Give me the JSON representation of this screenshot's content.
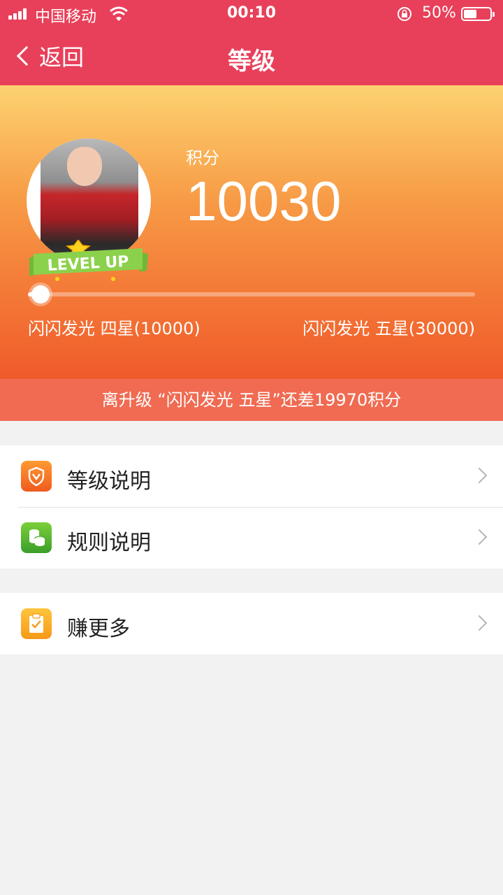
{
  "status_bar": {
    "carrier": "中国移动",
    "time": "00:10",
    "battery_text": "50%",
    "battery_level": 0.5
  },
  "nav": {
    "back_label": "返回",
    "title": "等级"
  },
  "hero": {
    "badge_text": "LEVEL UP",
    "score_label": "积分",
    "score": "10030",
    "progress": 0.003,
    "level_current": "闪闪发光 四星(10000)",
    "level_next": "闪闪发光 五星(30000)"
  },
  "banner": {
    "text": "离升级 “闪闪发光 五星”还差19970积分"
  },
  "menu": {
    "level_info": "等级说明",
    "rules_info": "规则说明",
    "earn_more": "赚更多"
  },
  "colors": {
    "nav_bg": "#e8405a",
    "banner_bg": "#f06b52"
  }
}
